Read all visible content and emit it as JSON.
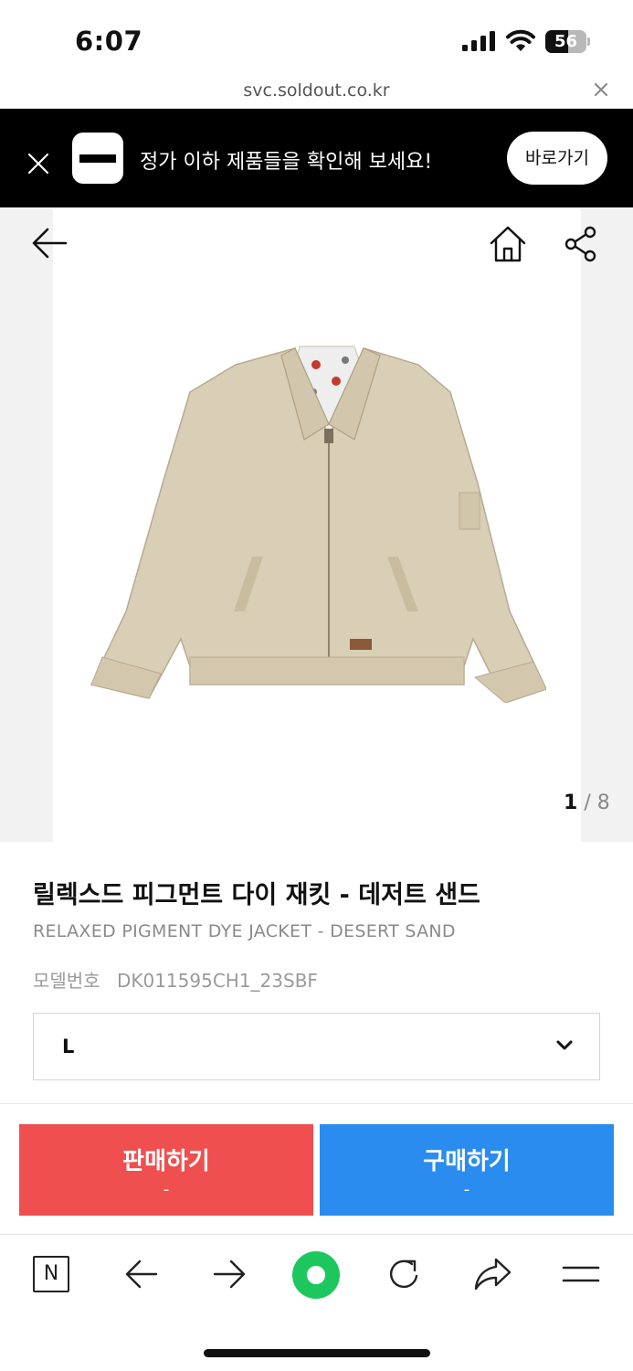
{
  "status_bar": {
    "time": "6:07",
    "battery_level": "56",
    "battery_fraction": 0.56,
    "icons": [
      "cellular-signal-icon",
      "wifi-icon",
      "battery-icon"
    ]
  },
  "browser": {
    "url": "svc.soldout.co.kr",
    "close_icon": "close-icon"
  },
  "banner": {
    "message": "정가 이하 제품들을 확인해 보세요!",
    "cta_label": "바로가기",
    "colors": {
      "background": "#000000",
      "text": "#ffffff"
    }
  },
  "product_nav": {
    "icons": [
      "back-arrow-icon",
      "home-icon",
      "share-icon"
    ]
  },
  "gallery": {
    "current": "1",
    "separator": "/",
    "total": "8"
  },
  "product": {
    "name_ko": "릴렉스드 피그먼트 다이 재킷 - 데저트 샌드",
    "name_en": "RELAXED PIGMENT DYE JACKET - DESERT SAND",
    "model_label": "모델번호",
    "model_number": "DK011595CH1_23SBF"
  },
  "size_select": {
    "selected": "L",
    "icon": "chevron-down-icon"
  },
  "actions": {
    "sell_label": "판매하기",
    "sell_price": "-",
    "buy_label": "구매하기",
    "buy_price": "-",
    "colors": {
      "sell": "#ef4f4f",
      "buy": "#2a8cee"
    }
  },
  "browser_toolbar": {
    "n_label": "N",
    "icons": [
      "naver-n-icon",
      "back-icon",
      "forward-icon",
      "green-dot-icon",
      "refresh-icon",
      "share-arrow-icon",
      "menu-icon"
    ],
    "accent": "#1ec75e"
  }
}
